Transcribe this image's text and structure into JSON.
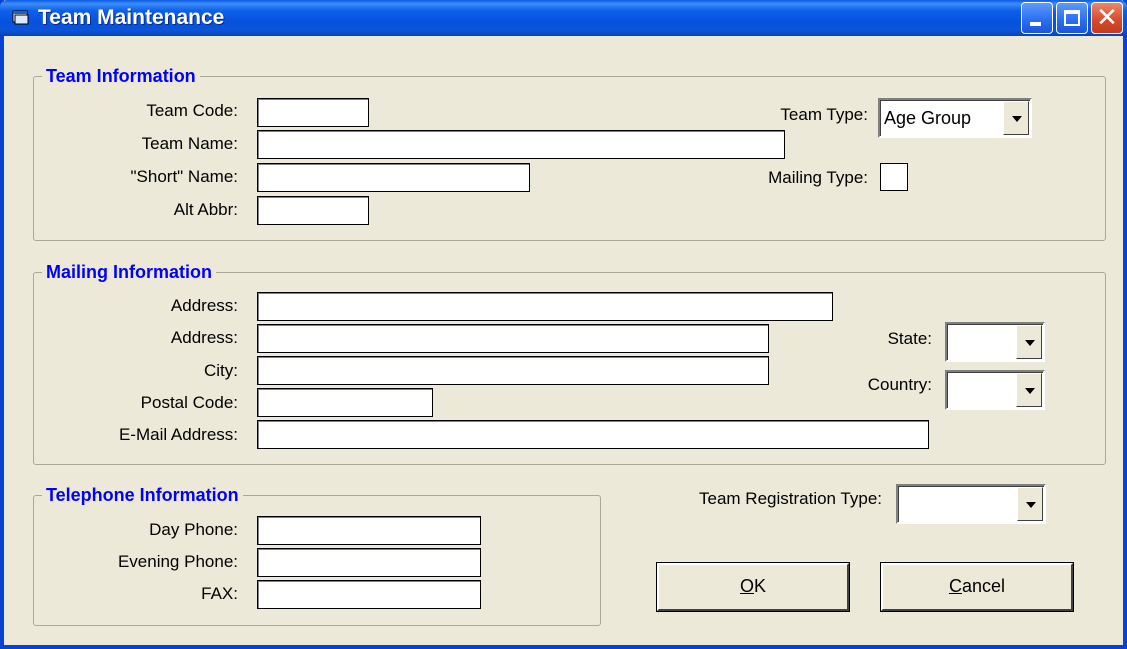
{
  "window": {
    "title": "Team Maintenance",
    "close_glyph": "✕"
  },
  "team_info": {
    "legend": "Team Information",
    "team_code_label": "Team Code:",
    "team_code_value": "",
    "team_name_label": "Team Name:",
    "team_name_value": "",
    "short_name_label": "\"Short\" Name:",
    "short_name_value": "",
    "alt_abbr_label": "Alt Abbr:",
    "alt_abbr_value": "",
    "team_type_label": "Team Type:",
    "team_type_value": "Age Group",
    "mailing_type_label": "Mailing Type:"
  },
  "mailing_info": {
    "legend": "Mailing Information",
    "address1_label": "Address:",
    "address1_value": "",
    "address2_label": "Address:",
    "address2_value": "",
    "city_label": "City:",
    "city_value": "",
    "postal_label": "Postal Code:",
    "postal_value": "",
    "email_label": "E-Mail Address:",
    "email_value": "",
    "state_label": "State:",
    "state_value": "",
    "country_label": "Country:",
    "country_value": ""
  },
  "telephone_info": {
    "legend": "Telephone Information",
    "day_label": "Day Phone:",
    "day_value": "",
    "evening_label": "Evening Phone:",
    "evening_value": "",
    "fax_label": "FAX:",
    "fax_value": ""
  },
  "registration": {
    "label": "Team Registration Type:",
    "value": ""
  },
  "buttons": {
    "ok_mnemonic": "O",
    "ok_rest": "K",
    "cancel_mnemonic": "C",
    "cancel_rest": "ancel"
  },
  "colors": {
    "titlebar": "#0a54d8",
    "legend_text": "#0000ff",
    "window_bg": "#ece9d8"
  }
}
